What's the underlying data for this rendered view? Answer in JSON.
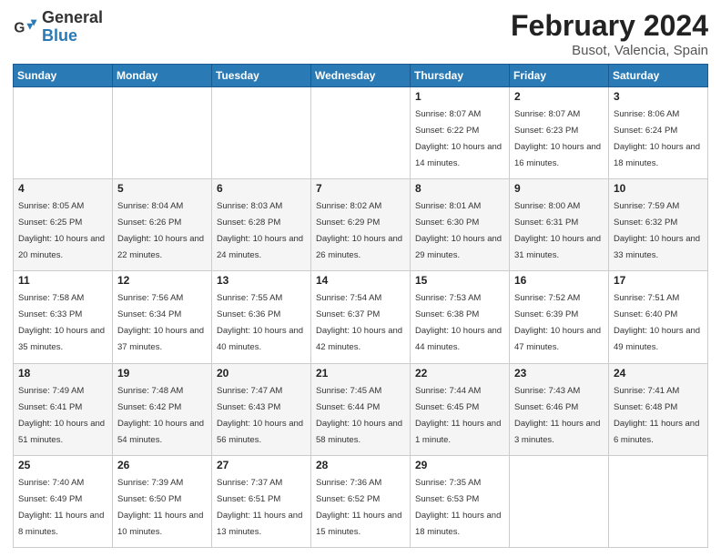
{
  "header": {
    "logo_general": "General",
    "logo_blue": "Blue",
    "title": "February 2024",
    "subtitle": "Busot, Valencia, Spain"
  },
  "days_of_week": [
    "Sunday",
    "Monday",
    "Tuesday",
    "Wednesday",
    "Thursday",
    "Friday",
    "Saturday"
  ],
  "weeks": [
    [
      {
        "day": "",
        "info": ""
      },
      {
        "day": "",
        "info": ""
      },
      {
        "day": "",
        "info": ""
      },
      {
        "day": "",
        "info": ""
      },
      {
        "day": "1",
        "info": "Sunrise: 8:07 AM\nSunset: 6:22 PM\nDaylight: 10 hours and 14 minutes."
      },
      {
        "day": "2",
        "info": "Sunrise: 8:07 AM\nSunset: 6:23 PM\nDaylight: 10 hours and 16 minutes."
      },
      {
        "day": "3",
        "info": "Sunrise: 8:06 AM\nSunset: 6:24 PM\nDaylight: 10 hours and 18 minutes."
      }
    ],
    [
      {
        "day": "4",
        "info": "Sunrise: 8:05 AM\nSunset: 6:25 PM\nDaylight: 10 hours and 20 minutes."
      },
      {
        "day": "5",
        "info": "Sunrise: 8:04 AM\nSunset: 6:26 PM\nDaylight: 10 hours and 22 minutes."
      },
      {
        "day": "6",
        "info": "Sunrise: 8:03 AM\nSunset: 6:28 PM\nDaylight: 10 hours and 24 minutes."
      },
      {
        "day": "7",
        "info": "Sunrise: 8:02 AM\nSunset: 6:29 PM\nDaylight: 10 hours and 26 minutes."
      },
      {
        "day": "8",
        "info": "Sunrise: 8:01 AM\nSunset: 6:30 PM\nDaylight: 10 hours and 29 minutes."
      },
      {
        "day": "9",
        "info": "Sunrise: 8:00 AM\nSunset: 6:31 PM\nDaylight: 10 hours and 31 minutes."
      },
      {
        "day": "10",
        "info": "Sunrise: 7:59 AM\nSunset: 6:32 PM\nDaylight: 10 hours and 33 minutes."
      }
    ],
    [
      {
        "day": "11",
        "info": "Sunrise: 7:58 AM\nSunset: 6:33 PM\nDaylight: 10 hours and 35 minutes."
      },
      {
        "day": "12",
        "info": "Sunrise: 7:56 AM\nSunset: 6:34 PM\nDaylight: 10 hours and 37 minutes."
      },
      {
        "day": "13",
        "info": "Sunrise: 7:55 AM\nSunset: 6:36 PM\nDaylight: 10 hours and 40 minutes."
      },
      {
        "day": "14",
        "info": "Sunrise: 7:54 AM\nSunset: 6:37 PM\nDaylight: 10 hours and 42 minutes."
      },
      {
        "day": "15",
        "info": "Sunrise: 7:53 AM\nSunset: 6:38 PM\nDaylight: 10 hours and 44 minutes."
      },
      {
        "day": "16",
        "info": "Sunrise: 7:52 AM\nSunset: 6:39 PM\nDaylight: 10 hours and 47 minutes."
      },
      {
        "day": "17",
        "info": "Sunrise: 7:51 AM\nSunset: 6:40 PM\nDaylight: 10 hours and 49 minutes."
      }
    ],
    [
      {
        "day": "18",
        "info": "Sunrise: 7:49 AM\nSunset: 6:41 PM\nDaylight: 10 hours and 51 minutes."
      },
      {
        "day": "19",
        "info": "Sunrise: 7:48 AM\nSunset: 6:42 PM\nDaylight: 10 hours and 54 minutes."
      },
      {
        "day": "20",
        "info": "Sunrise: 7:47 AM\nSunset: 6:43 PM\nDaylight: 10 hours and 56 minutes."
      },
      {
        "day": "21",
        "info": "Sunrise: 7:45 AM\nSunset: 6:44 PM\nDaylight: 10 hours and 58 minutes."
      },
      {
        "day": "22",
        "info": "Sunrise: 7:44 AM\nSunset: 6:45 PM\nDaylight: 11 hours and 1 minute."
      },
      {
        "day": "23",
        "info": "Sunrise: 7:43 AM\nSunset: 6:46 PM\nDaylight: 11 hours and 3 minutes."
      },
      {
        "day": "24",
        "info": "Sunrise: 7:41 AM\nSunset: 6:48 PM\nDaylight: 11 hours and 6 minutes."
      }
    ],
    [
      {
        "day": "25",
        "info": "Sunrise: 7:40 AM\nSunset: 6:49 PM\nDaylight: 11 hours and 8 minutes."
      },
      {
        "day": "26",
        "info": "Sunrise: 7:39 AM\nSunset: 6:50 PM\nDaylight: 11 hours and 10 minutes."
      },
      {
        "day": "27",
        "info": "Sunrise: 7:37 AM\nSunset: 6:51 PM\nDaylight: 11 hours and 13 minutes."
      },
      {
        "day": "28",
        "info": "Sunrise: 7:36 AM\nSunset: 6:52 PM\nDaylight: 11 hours and 15 minutes."
      },
      {
        "day": "29",
        "info": "Sunrise: 7:35 AM\nSunset: 6:53 PM\nDaylight: 11 hours and 18 minutes."
      },
      {
        "day": "",
        "info": ""
      },
      {
        "day": "",
        "info": ""
      }
    ]
  ]
}
